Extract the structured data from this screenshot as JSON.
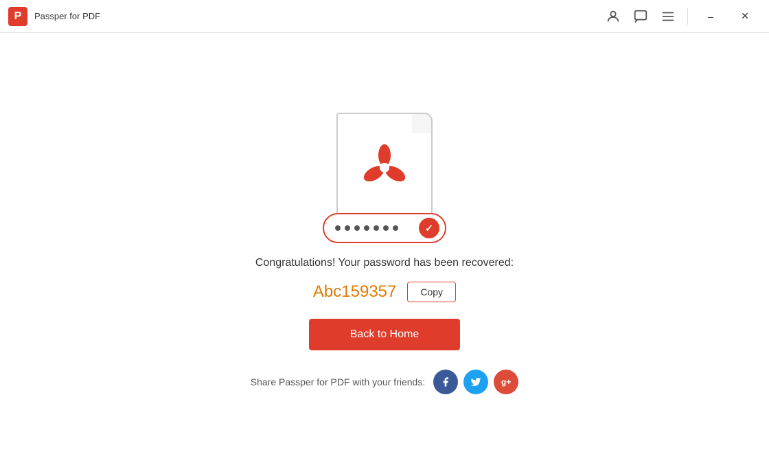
{
  "app": {
    "title": "Passper for PDF",
    "logo_letter": "P"
  },
  "titlebar": {
    "account_icon": "👤",
    "chat_icon": "💬",
    "menu_icon": "☰",
    "minimize_icon": "–",
    "close_icon": "✕"
  },
  "main": {
    "congrats_text": "Congratulations! Your password has been recovered:",
    "password": "Abc159357",
    "copy_label": "Copy",
    "back_home_label": "Back to Home",
    "share_text": "Share Passper for PDF with your friends:",
    "dots_count": 7
  },
  "social": [
    {
      "name": "facebook",
      "label": "f",
      "color": "#3b5998"
    },
    {
      "name": "twitter",
      "label": "t",
      "color": "#1da1f2"
    },
    {
      "name": "google-plus",
      "label": "g+",
      "color": "#dd4b39"
    }
  ],
  "colors": {
    "brand_red": "#e03c2b",
    "password_orange": "#e07a00"
  }
}
